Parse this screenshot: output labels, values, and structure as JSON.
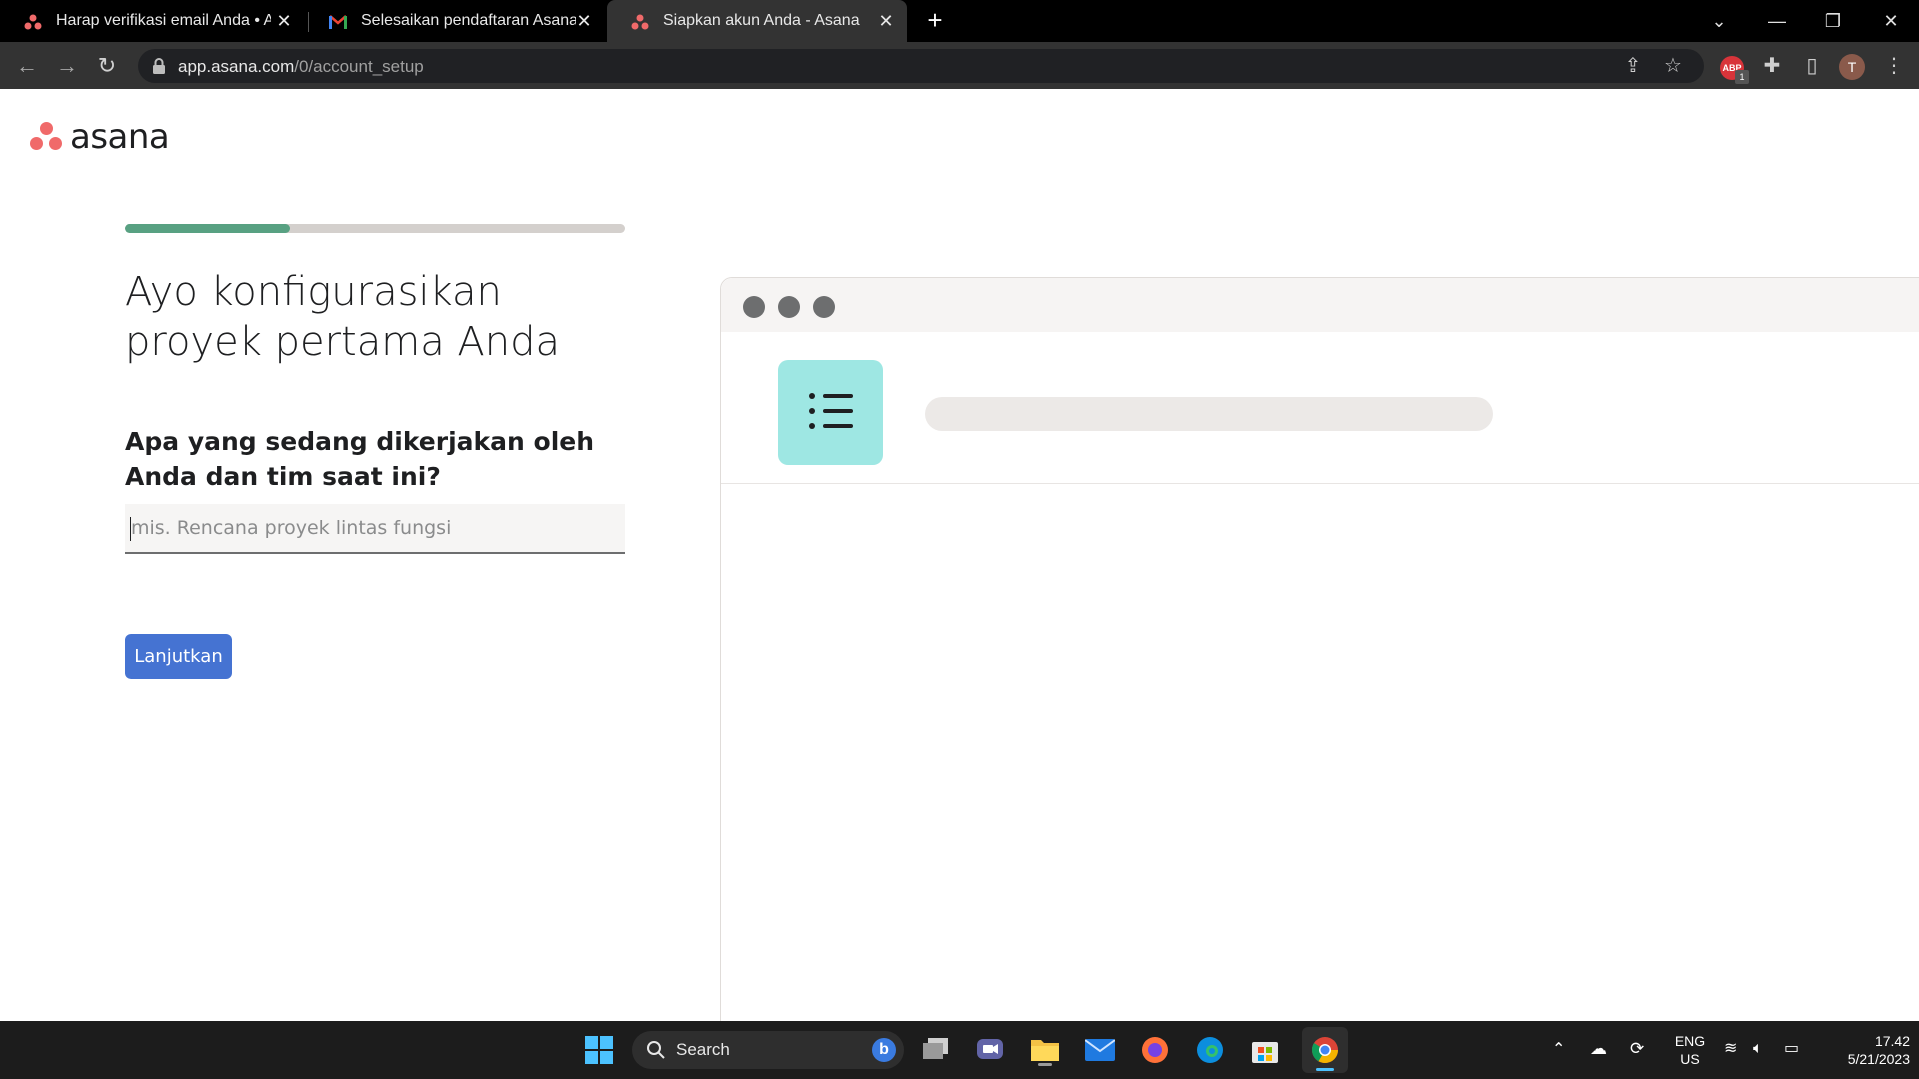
{
  "browser": {
    "tabs": [
      {
        "title": "Harap verifikasi email Anda • Asana",
        "active": false,
        "favicon": "asana-icon"
      },
      {
        "title": "Selesaikan pendaftaran Asana Anda",
        "active": false,
        "favicon": "gmail-icon"
      },
      {
        "title": "Siapkan akun Anda - Asana",
        "active": true,
        "favicon": "asana-icon"
      }
    ],
    "url_host": "app.asana.com",
    "url_path": "/0/account_setup",
    "profile_initial": "T",
    "abp_label": "ABP",
    "abp_count": "1"
  },
  "page": {
    "logo_text": "asana",
    "progress": 0.33,
    "heading": "Ayo konfigurasikan proyek pertama Anda",
    "question": "Apa yang sedang dikerjakan oleh Anda dan tim saat ini?",
    "input_placeholder": "mis. Rencana proyek lintas fungsi",
    "input_value": "",
    "continue_label": "Lanjutkan"
  },
  "taskbar": {
    "search_label": "Search",
    "language_line1": "ENG",
    "language_line2": "US",
    "time": "17.42",
    "date": "5/21/2023"
  },
  "colors": {
    "brand_coral": "#f06a6a",
    "progress_green": "#58a182",
    "button_blue": "#4573d2",
    "illustration_teal": "#9ee7e3"
  }
}
